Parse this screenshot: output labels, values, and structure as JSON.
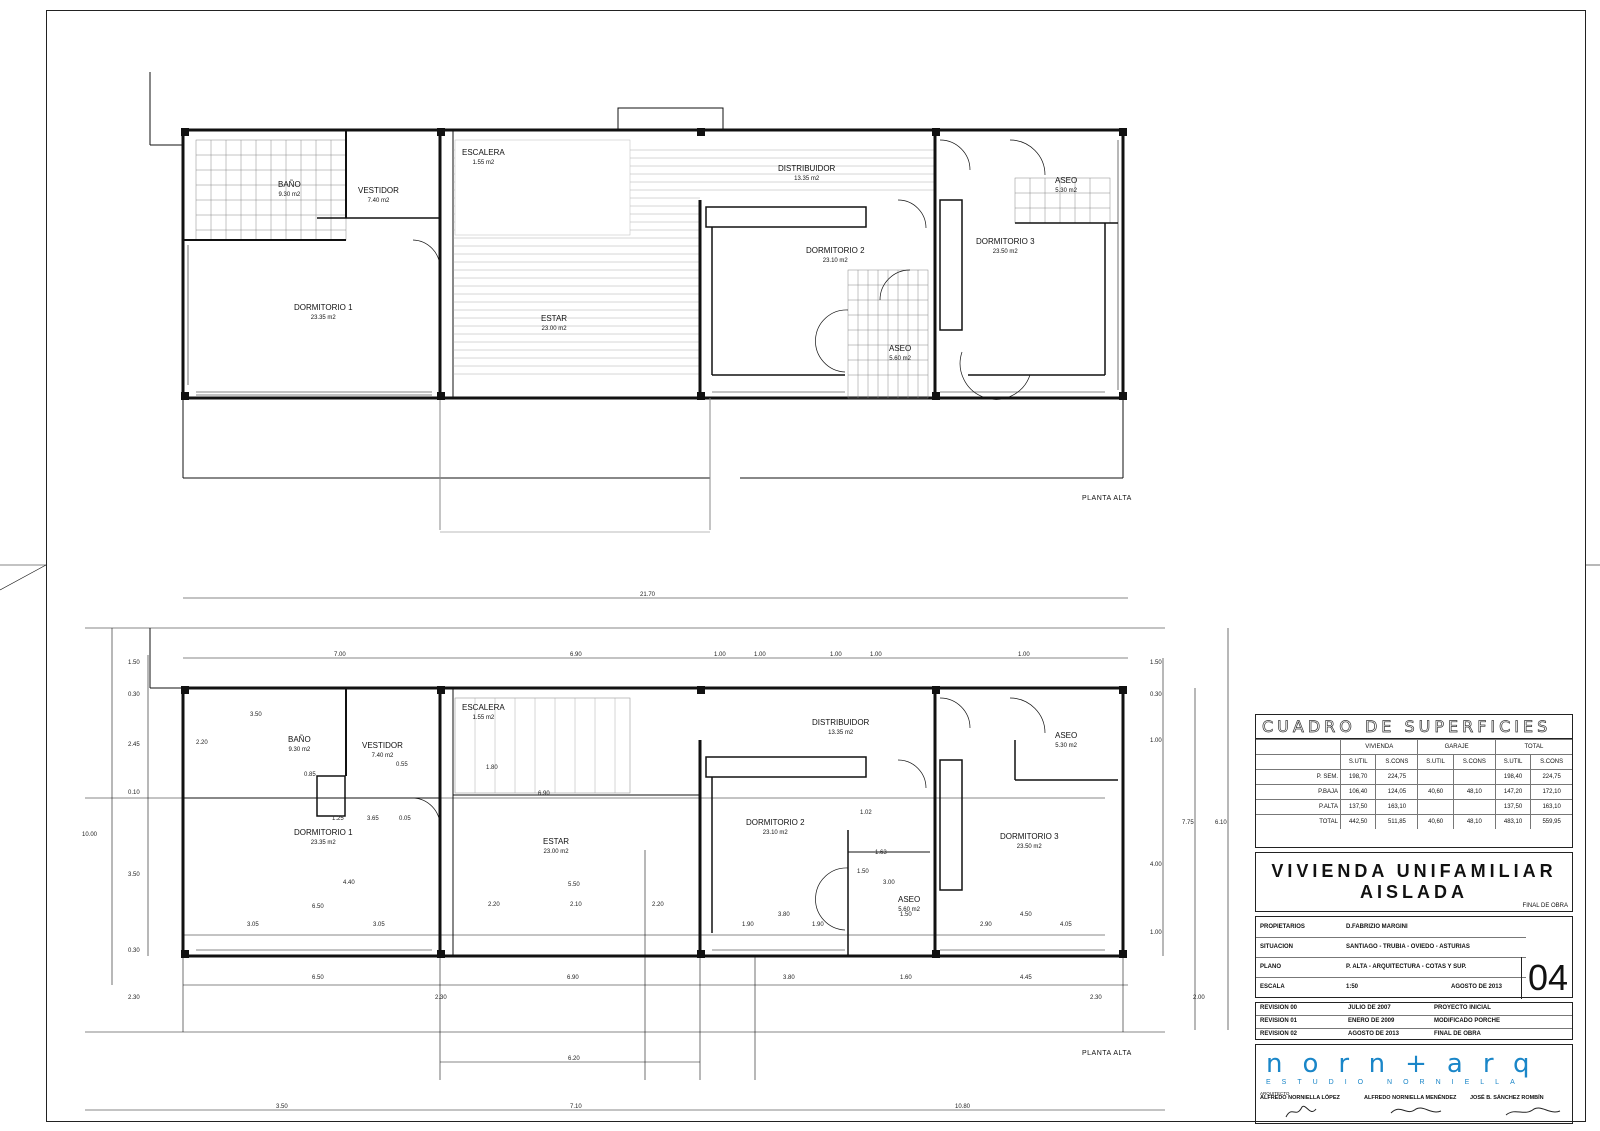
{
  "upper_plan": {
    "title": "PLANTA ALTA",
    "rooms": [
      {
        "name": "BAÑO",
        "area": "9.30 m2"
      },
      {
        "name": "VESTIDOR",
        "area": "7.40 m2"
      },
      {
        "name": "ESCALERA",
        "area": "1.55 m2"
      },
      {
        "name": "DISTRIBUIDOR",
        "area": "13.35 m2"
      },
      {
        "name": "ASEO",
        "area": "5.30 m2"
      },
      {
        "name": "DORMITORIO 1",
        "area": "23.35 m2"
      },
      {
        "name": "ESTAR",
        "area": "23.00 m2"
      },
      {
        "name": "DORMITORIO 2",
        "area": "23.10 m2"
      },
      {
        "name": "DORMITORIO 3",
        "area": "23.50 m2"
      },
      {
        "name": "ASEO",
        "area": "5.60 m2"
      }
    ]
  },
  "lower_plan": {
    "title": "PLANTA ALTA",
    "rooms": [
      {
        "name": "BAÑO",
        "area": "9.30 m2"
      },
      {
        "name": "VESTIDOR",
        "area": "7.40 m2"
      },
      {
        "name": "ESCALERA",
        "area": "1.55 m2"
      },
      {
        "name": "DISTRIBUIDOR",
        "area": "13.35 m2"
      },
      {
        "name": "ASEO",
        "area": "5.30 m2"
      },
      {
        "name": "DORMITORIO 1",
        "area": "23.35 m2"
      },
      {
        "name": "ESTAR",
        "area": "23.00 m2"
      },
      {
        "name": "DORMITORIO 2",
        "area": "23.10 m2"
      },
      {
        "name": "DORMITORIO 3",
        "area": "23.50 m2"
      },
      {
        "name": "ASEO",
        "area": "5.60 m2"
      }
    ],
    "dimensions": {
      "overall_top": "21.70",
      "top_chain": [
        "7.00",
        "6.90",
        "1.00",
        "1.00",
        "1.00",
        "1.00",
        "1.00"
      ],
      "bottom_chain": [
        "6.50",
        "6.90",
        "3.80",
        "1.60",
        "4.45"
      ],
      "bottom_overall": [
        "3.50",
        "7.10",
        "10.80"
      ],
      "left_chain": [
        "1.50",
        "0.30",
        "2.45",
        "0.10",
        "3.50",
        "0.30"
      ],
      "left_overall": "10.00",
      "right_chain": [
        "1.50",
        "0.30",
        "1.00",
        "4.00",
        "1.00"
      ],
      "right_overall": [
        "7.75",
        "6.10"
      ],
      "bottom_left": [
        "2.30",
        "2.30"
      ],
      "bottom_right": [
        "2.30",
        "2.00"
      ],
      "interior": [
        "3.50",
        "2.20",
        "0.85",
        "4.40",
        "1.25",
        "3.65",
        "0.05",
        "6.50",
        "3.05",
        "3.05",
        "5.50",
        "2.20",
        "2.10",
        "2.20",
        "1.90",
        "3.80",
        "1.90",
        "1.50",
        "2.90",
        "4.50",
        "4.05",
        "1.02",
        "1.50",
        "3.00",
        "1.63",
        "1.80",
        "0.55",
        "6.90",
        "6.20"
      ]
    }
  },
  "superficies": {
    "title": "CUADRO DE SUPERFICIES",
    "groups": [
      "VIVIENDA",
      "GARAJE",
      "TOTAL"
    ],
    "subheaders": [
      "S.UTIL",
      "S.CONS",
      "S.UTIL",
      "S.CONS",
      "S.UTIL",
      "S.CONS"
    ],
    "rows": [
      {
        "label": "P. SEM.",
        "values": [
          "198,70",
          "224,75",
          "",
          "",
          "198,40",
          "224,75"
        ]
      },
      {
        "label": "P.BAJA",
        "values": [
          "106,40",
          "124,05",
          "40,60",
          "48,10",
          "147,20",
          "172,10"
        ]
      },
      {
        "label": "P.ALTA",
        "values": [
          "137,50",
          "163,10",
          "",
          "",
          "137,50",
          "163,10"
        ]
      },
      {
        "label": "TOTAL",
        "values": [
          "442,50",
          "511,85",
          "40,60",
          "48,10",
          "483,10",
          "559,95"
        ]
      }
    ]
  },
  "project": {
    "line1": "VIVIENDA UNIFAMILIAR",
    "line2": "AISLADA",
    "stage": "FINAL DE OBRA"
  },
  "info": {
    "propietarios_label": "PROPIETARIOS",
    "propietarios": "D.FABRIZIO MARGINI",
    "situacion_label": "SITUACION",
    "situacion": "SANTIAGO - TRUBIA - OVIEDO - ASTURIAS",
    "plano_label": "PLANO",
    "plano": "P. ALTA - ARQUITECTURA - COTAS Y SUP.",
    "escala_label": "ESCALA",
    "escala": "1:50",
    "fecha": "AGOSTO DE 2013",
    "sheet_number": "04"
  },
  "revisions": [
    {
      "rev": "REVISION 00",
      "date": "JULIO DE 2007",
      "desc": "PROYECTO INICIAL"
    },
    {
      "rev": "REVISION 01",
      "date": "ENERO DE 2009",
      "desc": "MODIFICADO PORCHE"
    },
    {
      "rev": "REVISION 02",
      "date": "AGOSTO DE 2013",
      "desc": "FINAL DE OBRA"
    }
  ],
  "studio": {
    "logo": "norn+arq",
    "sub": "ESTUDIO NORNIELLA",
    "architect_label": "ARQUITECTO",
    "architects": [
      "ALFREDO NORNIELLA LÓPEZ",
      "ALFREDO NORNIELLA MENÉNDEZ",
      "JOSÉ B. SÁNCHEZ ROMBÍN"
    ]
  }
}
